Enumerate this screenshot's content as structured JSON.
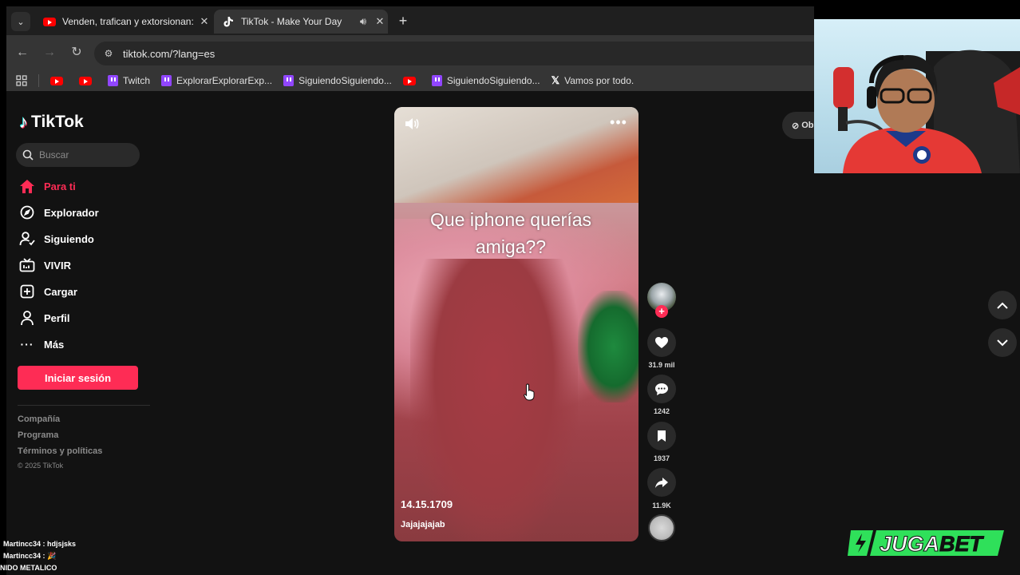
{
  "browser": {
    "tabs": [
      {
        "title": "Venden, trafican y extorsionan:",
        "favicon": "youtube-icon",
        "active": false
      },
      {
        "title": "TikTok - Make Your Day",
        "favicon": "tiktok-icon",
        "active": true,
        "audio": true
      }
    ],
    "url": "tiktok.com/?lang=es",
    "bookmarks": [
      {
        "label": "",
        "icon": "youtube-icon"
      },
      {
        "label": "",
        "icon": "youtube-icon"
      },
      {
        "label": "Twitch",
        "icon": "twitch-icon"
      },
      {
        "label": "ExplorarExplorarExp...",
        "icon": "twitch-icon"
      },
      {
        "label": "SiguiendoSiguiendo...",
        "icon": "twitch-icon"
      },
      {
        "label": "",
        "icon": "youtube-icon"
      },
      {
        "label": "SiguiendoSiguiendo...",
        "icon": "twitch-icon"
      },
      {
        "label": "Vamos por todo.",
        "icon": "x-icon"
      }
    ]
  },
  "tiktok": {
    "logo": "TikTok",
    "search_placeholder": "Buscar",
    "nav": [
      {
        "label": "Para ti",
        "icon": "home-icon",
        "active": true
      },
      {
        "label": "Explorador",
        "icon": "compass-icon"
      },
      {
        "label": "Siguiendo",
        "icon": "following-icon"
      },
      {
        "label": "VIVIR",
        "icon": "live-icon"
      },
      {
        "label": "Cargar",
        "icon": "upload-icon"
      },
      {
        "label": "Perfil",
        "icon": "profile-icon"
      },
      {
        "label": "Más",
        "icon": "more-icon"
      }
    ],
    "login_label": "Iniciar sesión",
    "footer_links": [
      "Compañía",
      "Programa",
      "Términos y políticas"
    ],
    "copyright": "© 2025 TikTok",
    "get_app_label": "Ob",
    "accent_color": "#fe2c55"
  },
  "video": {
    "caption_line1": "Que iphone querías",
    "caption_line2": "amiga??",
    "author": "14.15.1709",
    "description": "Jajajajajab",
    "likes": "31.9 mil",
    "comments": "1242",
    "saves": "1937",
    "shares": "11.9K"
  },
  "stream_overlay": {
    "chat": [
      {
        "user": "Martincc34",
        "message": "hdjsjsks"
      },
      {
        "user": "Martincc34",
        "message": "🎉"
      }
    ],
    "chat_footer": "NIDO METALICO",
    "sponsor": "JUGABET"
  }
}
